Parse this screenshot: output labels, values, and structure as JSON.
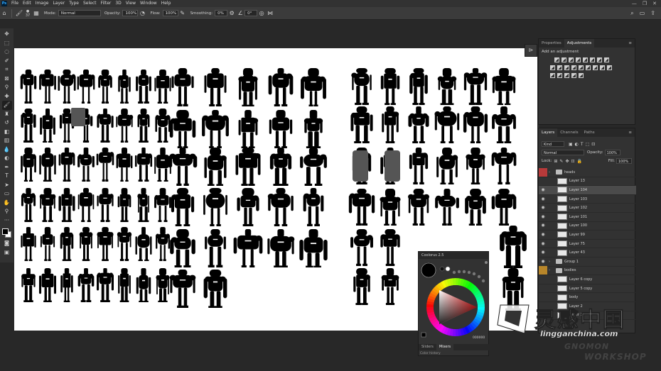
{
  "app": {
    "logo_text": "Ps"
  },
  "menu": [
    "File",
    "Edit",
    "Image",
    "Layer",
    "Type",
    "Select",
    "Filter",
    "3D",
    "View",
    "Window",
    "Help"
  ],
  "window_controls": [
    "—",
    "❐",
    "✕"
  ],
  "options_bar": {
    "brush_size": "37",
    "mode_label": "Mode:",
    "mode_value": "Normal",
    "opacity_label": "Opacity:",
    "opacity_value": "100%",
    "flow_label": "Flow:",
    "flow_value": "100%",
    "smoothing_label": "Smoothing:",
    "smoothing_value": "0%",
    "angle_value": "0°"
  },
  "properties_panel": {
    "tabs": [
      "Properties",
      "Adjustments"
    ],
    "active_tab": "Adjustments",
    "title": "Add an adjustment"
  },
  "layers_panel": {
    "tabs": [
      "Layers",
      "Channels",
      "Paths"
    ],
    "filter_value": "Kind",
    "blend_mode": "Normal",
    "opacity_label": "Opacity:",
    "opacity_value": "100%",
    "lock_label": "Lock:",
    "fill_label": "Fill:",
    "fill_value": "100%",
    "layers": [
      {
        "name": "heads",
        "type": "group",
        "tag": "#b83a3a",
        "visible": false
      },
      {
        "name": "Layer 13",
        "type": "layer",
        "tag": "",
        "visible": false
      },
      {
        "name": "Layer 104",
        "type": "layer",
        "tag": "",
        "visible": true,
        "selected": true
      },
      {
        "name": "Layer 103",
        "type": "layer",
        "tag": "",
        "visible": true
      },
      {
        "name": "Layer 102",
        "type": "layer",
        "tag": "",
        "visible": true
      },
      {
        "name": "Layer 101",
        "type": "layer",
        "tag": "",
        "visible": true
      },
      {
        "name": "Layer 100",
        "type": "layer",
        "tag": "",
        "visible": true
      },
      {
        "name": "Layer 99",
        "type": "layer",
        "tag": "",
        "visible": true
      },
      {
        "name": "Layer 75",
        "type": "layer",
        "tag": "",
        "visible": true
      },
      {
        "name": "Layer 43",
        "type": "layer",
        "tag": "",
        "visible": true
      },
      {
        "name": "Group 1",
        "type": "group",
        "tag": "",
        "visible": true
      },
      {
        "name": "bodies",
        "type": "group",
        "tag": "#b8862a",
        "visible": false
      },
      {
        "name": "Layer 6 copy",
        "type": "layer",
        "tag": "",
        "visible": false
      },
      {
        "name": "Layer 5 copy",
        "type": "layer",
        "tag": "",
        "visible": false
      },
      {
        "name": "body",
        "type": "layer",
        "tag": "",
        "visible": false
      },
      {
        "name": "Layer 2",
        "type": "layer",
        "tag": "",
        "visible": false
      },
      {
        "name": "Layer 1",
        "type": "layer",
        "tag": "",
        "visible": false
      }
    ]
  },
  "coolorus": {
    "title": "Coolorus 2.5",
    "hex": "000000",
    "tabs": [
      "Sliders",
      "Mixers"
    ],
    "active_tab": "Mixers",
    "history_label": "Color history"
  },
  "watermark": {
    "cn": "灵感中国",
    "url": "lingganchina.com",
    "en1": "GNOMON",
    "en2": "WORKSHOP"
  },
  "colors": {
    "app_bg": "#282828",
    "panel_bg": "#323232",
    "canvas": "#ffffff",
    "silhouette": "#000000"
  },
  "icons": {
    "tools": [
      "move-icon",
      "marquee-icon",
      "lasso-icon",
      "quick-select-icon",
      "crop-icon",
      "frame-icon",
      "eyedropper-icon",
      "healing-icon",
      "brush-icon",
      "stamp-icon",
      "history-brush-icon",
      "eraser-icon",
      "gradient-icon",
      "blur-icon",
      "dodge-icon",
      "pen-icon",
      "type-icon",
      "path-select-icon",
      "rectangle-icon",
      "hand-icon",
      "zoom-icon",
      "more-icon"
    ]
  }
}
